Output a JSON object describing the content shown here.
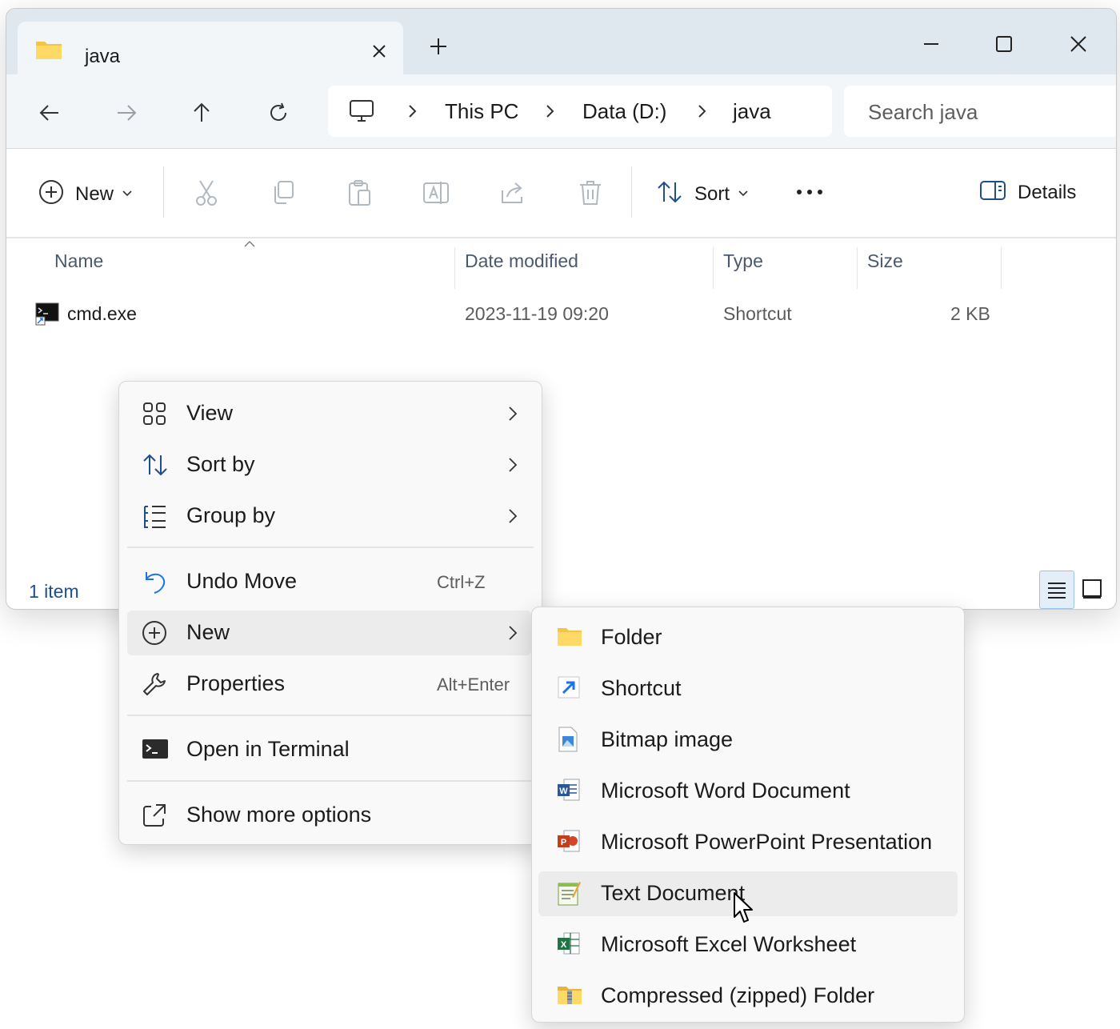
{
  "window": {
    "tab_title": "java",
    "tab_icon": "folder-icon",
    "controls": [
      "minimize-icon",
      "maximize-icon",
      "close-icon"
    ]
  },
  "nav": {
    "breadcrumbs": [
      "This PC",
      "Data (D:)",
      "java"
    ],
    "search_placeholder": "Search java"
  },
  "toolbar": {
    "new_label": "New",
    "sort_label": "Sort",
    "details_label": "Details"
  },
  "columns": {
    "name": "Name",
    "date": "Date modified",
    "type": "Type",
    "size": "Size"
  },
  "files": [
    {
      "name": "cmd.exe",
      "date": "2023-11-19 09:20",
      "type": "Shortcut",
      "size": "2 KB"
    }
  ],
  "status": {
    "count": "1 item"
  },
  "context_menu": {
    "view": "View",
    "sort_by": "Sort by",
    "group_by": "Group by",
    "undo_move": "Undo Move",
    "undo_shortcut": "Ctrl+Z",
    "new": "New",
    "properties": "Properties",
    "properties_shortcut": "Alt+Enter",
    "open_terminal": "Open in Terminal",
    "show_more": "Show more options"
  },
  "new_submenu": [
    {
      "label": "Folder",
      "icon": "folder-icon"
    },
    {
      "label": "Shortcut",
      "icon": "shortcut-icon"
    },
    {
      "label": "Bitmap image",
      "icon": "bitmap-icon"
    },
    {
      "label": "Microsoft Word Document",
      "icon": "word-icon"
    },
    {
      "label": "Microsoft PowerPoint Presentation",
      "icon": "powerpoint-icon"
    },
    {
      "label": "Text Document",
      "icon": "text-document-icon"
    },
    {
      "label": "Microsoft Excel Worksheet",
      "icon": "excel-icon"
    },
    {
      "label": "Compressed (zipped) Folder",
      "icon": "zip-folder-icon"
    }
  ],
  "colors": {
    "titlebar": "#dfe8ef",
    "navbar": "#f3f6f9",
    "accent": "#0067c0",
    "hover": "#ececec"
  }
}
